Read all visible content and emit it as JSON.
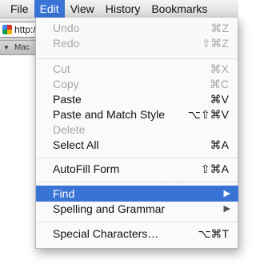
{
  "menubar": {
    "items": [
      "File",
      "Edit",
      "View",
      "History",
      "Bookmarks"
    ],
    "active": "Edit"
  },
  "browser": {
    "url_text": "http:/",
    "bookmark_label": "Mac"
  },
  "edit_menu": {
    "undo": {
      "label": "Undo",
      "shortcut": "⌘Z"
    },
    "redo": {
      "label": "Redo",
      "shortcut": "⇧⌘Z"
    },
    "cut": {
      "label": "Cut",
      "shortcut": "⌘X"
    },
    "copy": {
      "label": "Copy",
      "shortcut": "⌘C"
    },
    "paste": {
      "label": "Paste",
      "shortcut": "⌘V"
    },
    "paste_match": {
      "label": "Paste and Match Style",
      "shortcut": "⌥⇧⌘V"
    },
    "delete": {
      "label": "Delete"
    },
    "select_all": {
      "label": "Select All",
      "shortcut": "⌘A"
    },
    "autofill": {
      "label": "AutoFill Form",
      "shortcut": "⇧⌘A"
    },
    "find": {
      "label": "Find",
      "submenu_icon": "submenu-arrow-icon"
    },
    "spelling": {
      "label": "Spelling and Grammar",
      "submenu_icon": "submenu-arrow-icon"
    },
    "special_chars": {
      "label": "Special Characters…",
      "shortcut": "⌥⌘T"
    }
  },
  "colors": {
    "highlight": "#3a73d6"
  }
}
